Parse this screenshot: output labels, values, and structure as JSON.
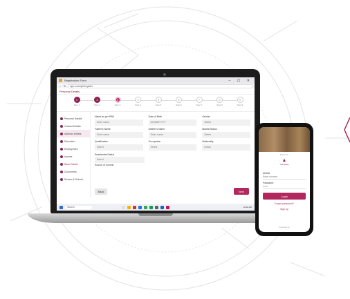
{
  "browser": {
    "title": "Registration Form",
    "url": "app.example/register",
    "window_controls": "– ▢ ✕"
  },
  "app": {
    "header": "Personal Details"
  },
  "stepper": {
    "steps": [
      {
        "num": "1",
        "label": "Step 1",
        "state": "done"
      },
      {
        "num": "2",
        "label": "Step 2",
        "state": "done"
      },
      {
        "num": "3",
        "label": "Step 3",
        "state": "active"
      },
      {
        "num": "4",
        "label": "Step 4",
        "state": "todo"
      },
      {
        "num": "5",
        "label": "Step 5",
        "state": "todo"
      },
      {
        "num": "6",
        "label": "Step 6",
        "state": "todo"
      },
      {
        "num": "7",
        "label": "Step 7",
        "state": "todo"
      },
      {
        "num": "8",
        "label": "Step 8",
        "state": "todo"
      },
      {
        "num": "9",
        "label": "Step 9",
        "state": "todo"
      }
    ]
  },
  "sidebar": {
    "items": [
      {
        "label": "Personal Details"
      },
      {
        "label": "Contact Details"
      },
      {
        "label": "Address Details"
      },
      {
        "label": "Education"
      },
      {
        "label": "Employment"
      },
      {
        "label": "Income"
      },
      {
        "label": "Bank Details"
      },
      {
        "label": "Documents"
      },
      {
        "label": "Review & Submit"
      }
    ]
  },
  "form": {
    "fields": [
      {
        "label": "Name as per PAN",
        "value": "Enter name"
      },
      {
        "label": "Date of Birth",
        "value": "DD/MM/YYYY"
      },
      {
        "label": "Gender",
        "value": "Select"
      },
      {
        "label": "Father's Name",
        "value": "Enter name"
      },
      {
        "label": "Mother's Name",
        "value": "Enter name"
      },
      {
        "label": "Marital Status",
        "value": "Select"
      },
      {
        "label": "Qualification",
        "value": "Select"
      },
      {
        "label": "Occupation",
        "value": "Select"
      },
      {
        "label": "Nationality",
        "value": "Indian"
      }
    ],
    "extra_label": "Residential Status",
    "extra_value": "Select",
    "extra_label2": "Source of Income",
    "back_label": "Back",
    "next_label": "Next"
  },
  "taskbar": {
    "search": "Search",
    "time": "10:42 AM"
  },
  "phone": {
    "subtitle": "Welcome",
    "brand": "Company",
    "fields": [
      {
        "label": "Mobile",
        "value": "Enter number"
      },
      {
        "label": "Password",
        "value": "••••••"
      }
    ],
    "button": "Login",
    "link": "Forgot password?",
    "link2": "Sign up",
    "footer": "Powered by"
  },
  "colors": {
    "accent": "#b0285e",
    "accent_dark": "#8b2252"
  }
}
